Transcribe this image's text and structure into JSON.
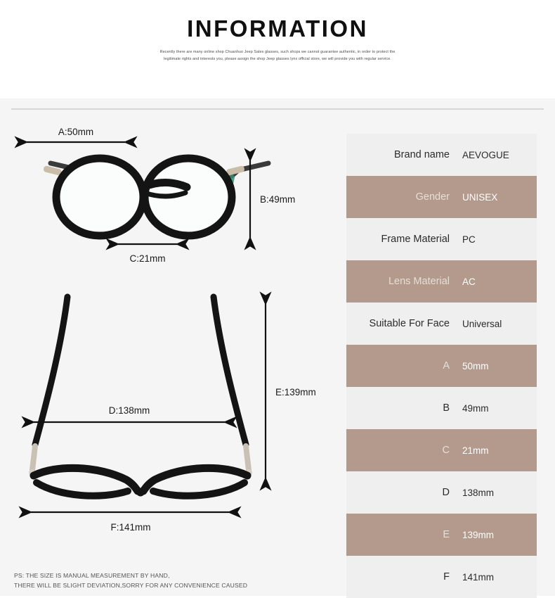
{
  "header": {
    "title": "INFORMATION",
    "intro": "Recently there are many online shop Chuanhuo Jeep Sales glasses, such shops we cannot guarantee authentic, in order to protect the legitimate rights and interests you, please assign the shop Jeep glasses lynx official store, we will provide you with regular service."
  },
  "diagrams": {
    "front": {
      "dim_a": "A:50mm",
      "dim_b": "B:49mm",
      "dim_c": "C:21mm"
    },
    "top": {
      "dim_d": "D:138mm",
      "dim_e": "E:139mm",
      "dim_f": "F:141mm"
    }
  },
  "footnote": {
    "line1": "PS: THE SIZE IS MANUAL MEASUREMENT BY HAND,",
    "line2": "THERE WILL BE SLIGHT DEVIATION,SORRY FOR ANY CONVENIENCE CAUSED"
  },
  "colors": {
    "row_light": "#efefef",
    "row_dark": "#b39a8c",
    "panel_background": "#f5f5f5",
    "frame_black": "#141414",
    "temple_accent": "#2f8f76"
  },
  "spec_table": {
    "rows": [
      {
        "label": "Brand name",
        "value": "AEVOGUE"
      },
      {
        "label": "Gender",
        "value": "UNISEX"
      },
      {
        "label": "Frame Material",
        "value": "PC"
      },
      {
        "label": "Lens Material",
        "value": "AC"
      },
      {
        "label": "Suitable For Face",
        "value": "Universal"
      },
      {
        "label": "A",
        "value": "50mm"
      },
      {
        "label": "B",
        "value": "49mm"
      },
      {
        "label": "C",
        "value": "21mm"
      },
      {
        "label": "D",
        "value": "138mm"
      },
      {
        "label": "E",
        "value": "139mm"
      },
      {
        "label": "F",
        "value": "141mm"
      }
    ]
  }
}
